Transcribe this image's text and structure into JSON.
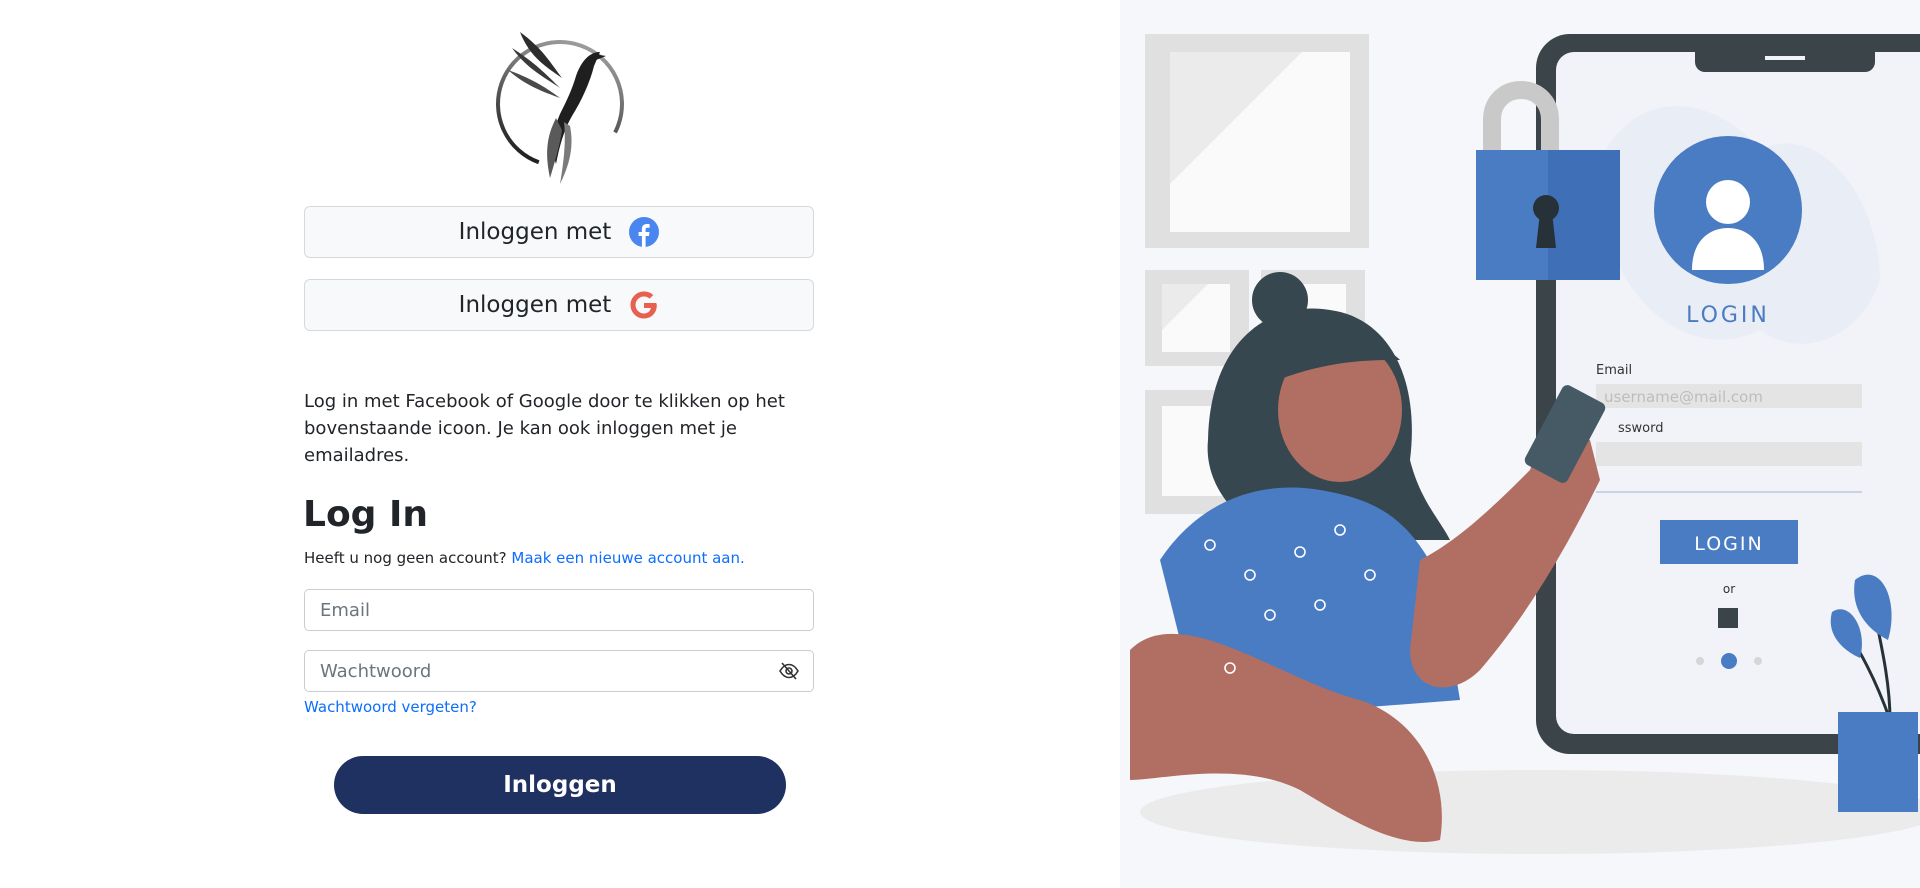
{
  "social": {
    "facebook_label": "Inloggen met",
    "google_label": "Inloggen met"
  },
  "info_text": "Log in met Facebook of Google door te klikken op het bovenstaande icoon. Je kan ook inloggen met je emailadres.",
  "form": {
    "title": "Log In",
    "signup_prompt": "Heeft u nog geen account?",
    "signup_link": "Maak een nieuwe account aan.",
    "email_placeholder": "Email",
    "password_placeholder": "Wachtwoord",
    "forgot_link": "Wachtwoord vergeten?",
    "submit_label": "Inloggen"
  },
  "illustration": {
    "phone_login_heading": "LOGIN",
    "email_label": "Email",
    "email_value": "username@mail.com",
    "password_label": "ssword",
    "login_button": "LOGIN",
    "or_text": "or"
  },
  "colors": {
    "primary_button": "#1f3161",
    "link": "#0d6efd",
    "illustration_blue": "#4a7cc4"
  },
  "icons": {
    "facebook": "facebook-icon",
    "google": "google-icon",
    "password_toggle": "eye-slash-icon"
  }
}
